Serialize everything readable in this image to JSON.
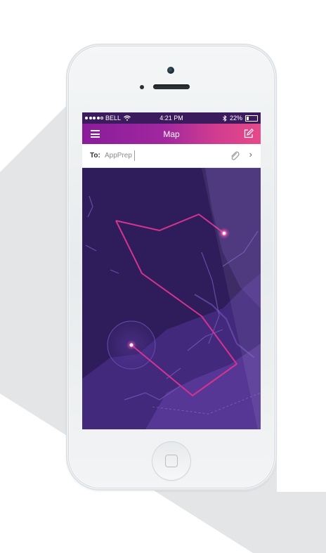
{
  "status_bar": {
    "carrier": "BELL",
    "time": "4:21 PM",
    "battery": "22%",
    "battery_level": 0.22
  },
  "nav_bar": {
    "title": "Map",
    "left_icon": "hamburger-menu-icon",
    "right_icon": "compose-icon"
  },
  "recipient": {
    "label": "To:",
    "value": "AppPrep",
    "attach_icon": "paperclip-icon",
    "more_icon": "chevron-right-icon"
  },
  "colors": {
    "nav_gradient_start": "#8a1c9c",
    "nav_gradient_end": "#e64a8a",
    "map_background": "#2f1d5b",
    "route_color": "#d2348f",
    "land_color": "#5a3a9a"
  }
}
